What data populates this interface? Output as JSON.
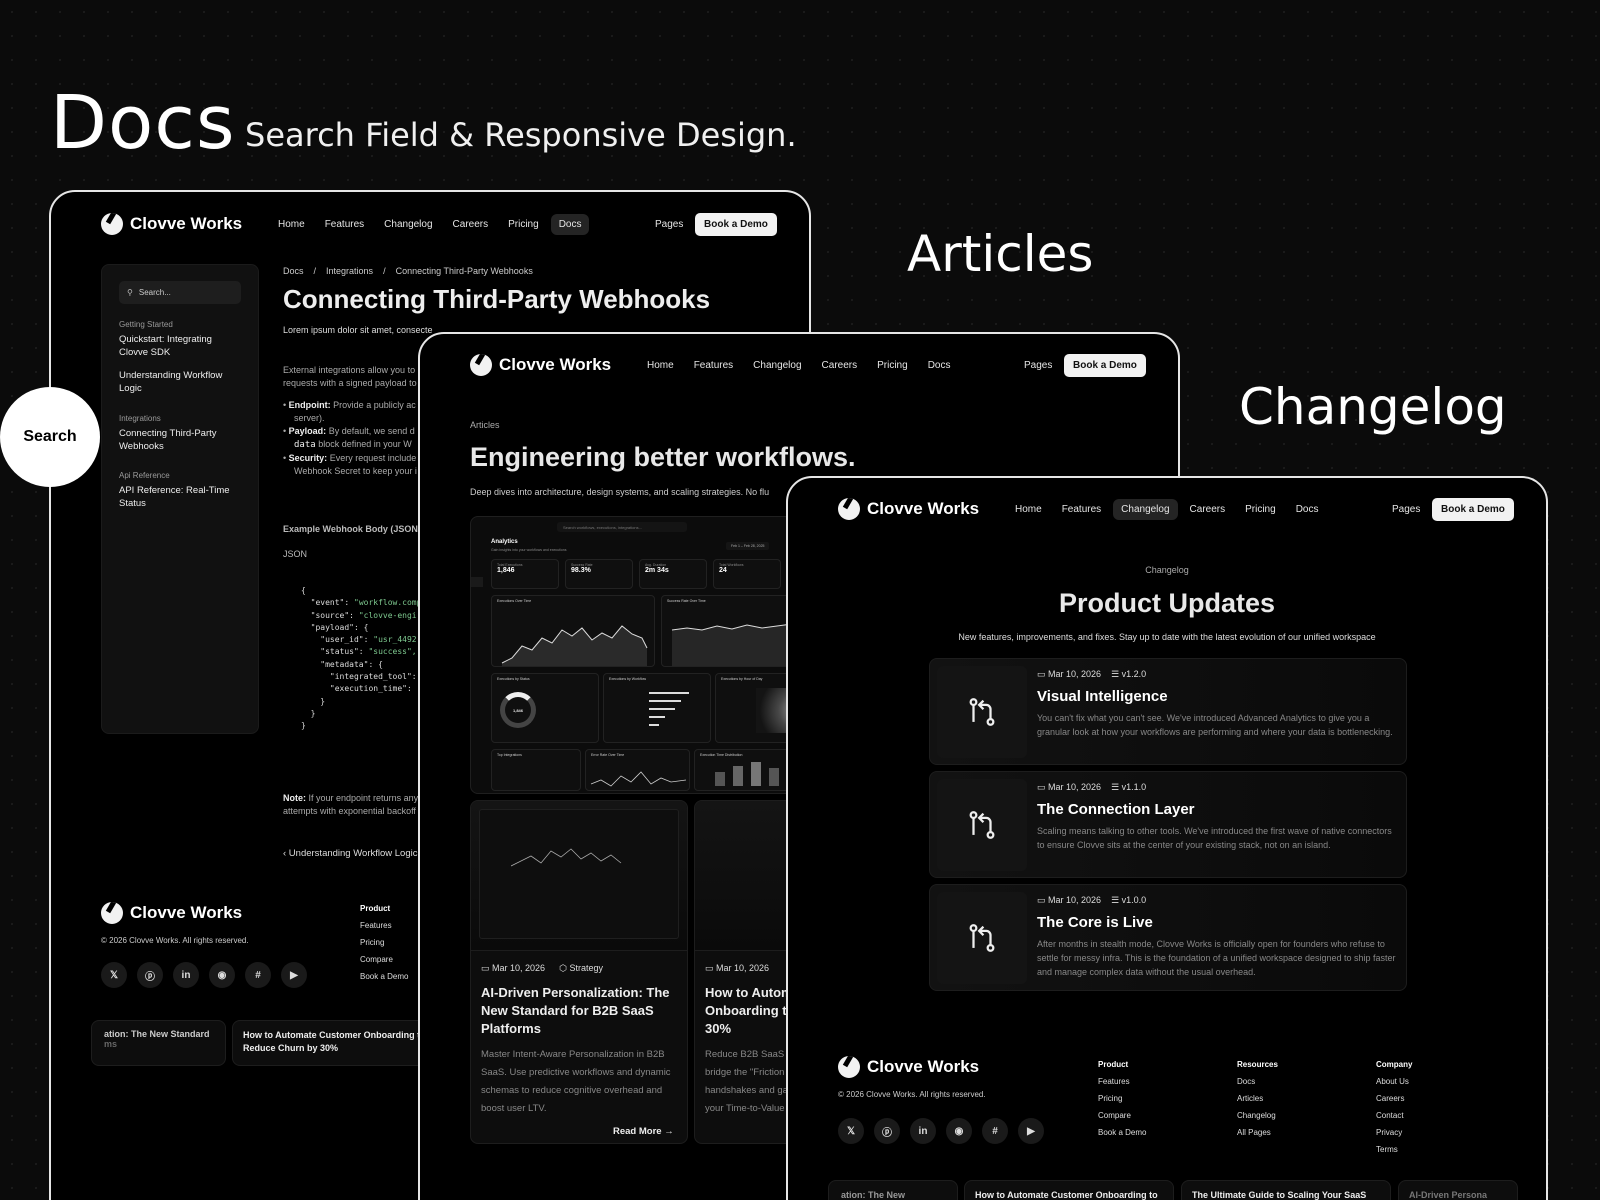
{
  "header": {
    "title": "Docs",
    "subtitle": "Search Field & Responsive Design."
  },
  "labels": {
    "articles": "Articles",
    "changelog": "Changelog",
    "search_bubble": "Search"
  },
  "brand": "Clovve Works",
  "nav": {
    "links": [
      "Home",
      "Features",
      "Changelog",
      "Careers",
      "Pricing",
      "Docs"
    ],
    "pages": "Pages",
    "demo": "Book a Demo"
  },
  "docs": {
    "search_placeholder": "Search...",
    "sidebar": [
      {
        "group": "Getting Started",
        "items": [
          "Quickstart: Integrating Clovve SDK",
          "Understanding Workflow Logic"
        ]
      },
      {
        "group": "Integrations",
        "items": [
          "Connecting Third-Party Webhooks"
        ]
      },
      {
        "group": "Api Reference",
        "items": [
          "API Reference: Real-Time Status"
        ]
      }
    ],
    "breadcrumb": [
      "Docs",
      "Integrations",
      "Connecting Third-Party Webhooks"
    ],
    "title": "Connecting Third-Party Webhooks",
    "lead": "Lorem ipsum dolor sit amet, consecte",
    "intro": [
      "External integrations allow you to",
      "requests with a signed payload to"
    ],
    "bullets": [
      {
        "label": "Endpoint:",
        "text": "Provide a publicly ac",
        "cont": "server)."
      },
      {
        "label": "Payload:",
        "text": "By default, we send d",
        "code": "data",
        "cont": "block defined in your W"
      },
      {
        "label": "Security:",
        "text": "Every request include",
        "cont": "Webhook Secret to keep your i"
      }
    ],
    "example_label": "Example Webhook Body (JSON):",
    "code_lang": "JSON",
    "code_lines": [
      "{",
      "  \"event\": \"workflow.comp",
      "  \"source\": \"clovve-engi",
      "  \"payload\": {",
      "    \"user_id\": \"usr_4492",
      "    \"status\": \"success\",",
      "    \"metadata\": {",
      "      \"integrated_tool\":",
      "      \"execution_time\": ",
      "    }",
      "  }",
      "}"
    ],
    "note_label": "Note:",
    "note_text": "If your endpoint returns any",
    "note_text2": "attempts with exponential backoff",
    "prev_link": "‹ Understanding Workflow Logic",
    "copyright": "© 2026 Clovve Works. All rights reserved.",
    "footer_product": [
      "Product",
      "Features",
      "Pricing",
      "Compare",
      "Book a Demo"
    ],
    "bottom_cards": [
      "ation: The New Standard",
      "ms",
      "How to Automate Customer Onboarding t",
      "Reduce Churn by 30%"
    ]
  },
  "articles": {
    "eyebrow": "Articles",
    "title": "Engineering better workflows.",
    "subtitle": "Deep dives into architecture, design systems, and scaling strategies. No flu",
    "dash": {
      "search": "Search workflows, executions, integrations...",
      "title": "Analytics",
      "subtitle": "Gain insights into your workflows and executions",
      "date": "Feb 1 – Feb 28, 2025",
      "stats": [
        {
          "label": "Total Executions",
          "value": "1,846"
        },
        {
          "label": "Success Rate",
          "value": "98.3%"
        },
        {
          "label": "Avg. Duration",
          "value": "2m 34s"
        },
        {
          "label": "Total Workflows",
          "value": "24"
        }
      ],
      "chart1": "Executions Over Time",
      "chart2": "Success Rate Over Time",
      "donut_title": "Executions by Status",
      "donut_value": "1,846",
      "wf_title": "Executions by Workflow",
      "heat_title": "Executions by Hour of Day",
      "int_title": "Top Integrations",
      "err_title": "Error Rate Over Time",
      "dist_title": "Execution Time Distribution"
    },
    "cards": [
      {
        "date": "Mar 10, 2026",
        "tag": "Strategy",
        "title": "AI-Driven Personalization: The New Standard for B2B SaaS Platforms",
        "excerpt": "Master Intent-Aware Personalization in B2B SaaS. Use predictive workflows and dynamic schemas to reduce cognitive overhead and boost user LTV.",
        "read": "Read More →"
      },
      {
        "date": "Mar 10, 2026",
        "title": "How to Autom Onboarding to 30%",
        "excerpt": "Reduce B2B SaaS c bridge the \"Friction handshakes and ga your Time-to-Value"
      }
    ]
  },
  "changelog": {
    "eyebrow": "Changelog",
    "title": "Product Updates",
    "subtitle": "New features, improvements, and fixes. Stay up to date with the latest evolution of our unified workspace",
    "entries": [
      {
        "date": "Mar 10, 2026",
        "version": "v1.2.0",
        "title": "Visual Intelligence",
        "desc": "You can't fix what you can't see. We've introduced Advanced Analytics to give you a granular look at how your workflows are performing and where your data is bottlenecking."
      },
      {
        "date": "Mar 10, 2026",
        "version": "v1.1.0",
        "title": "The Connection Layer",
        "desc": "Scaling means talking to other tools. We've introduced the first wave of native connectors to ensure Clovve sits at the center of your existing stack, not on an island."
      },
      {
        "date": "Mar 10, 2026",
        "version": "v1.0.0",
        "title": "The Core is Live",
        "desc": "After months in stealth mode, Clovve Works is officially open for founders who refuse to settle for messy infra. This is the foundation of a unified workspace designed to ship faster and manage complex data without the usual overhead."
      }
    ],
    "copyright": "© 2026 Clovve Works. All rights reserved.",
    "footer_cols": [
      [
        "Product",
        "Features",
        "Pricing",
        "Compare",
        "Book a Demo"
      ],
      [
        "Resources",
        "Docs",
        "Articles",
        "Changelog",
        "All Pages"
      ],
      [
        "Company",
        "About Us",
        "Careers",
        "Contact",
        "Privacy",
        "Terms"
      ]
    ],
    "bottom_cards": [
      "ation: The New Standard",
      "How to Automate Customer Onboarding to",
      "The Ultimate Guide to Scaling Your SaaS",
      "AI-Driven Persona"
    ]
  },
  "social_icons": [
    "x-icon",
    "pinterest-icon",
    "linkedin-icon",
    "discord-icon",
    "slack-icon",
    "youtube-icon"
  ],
  "social_glyphs": [
    "𝕏",
    "ⓟ",
    "in",
    "◉",
    "#",
    "▶"
  ]
}
